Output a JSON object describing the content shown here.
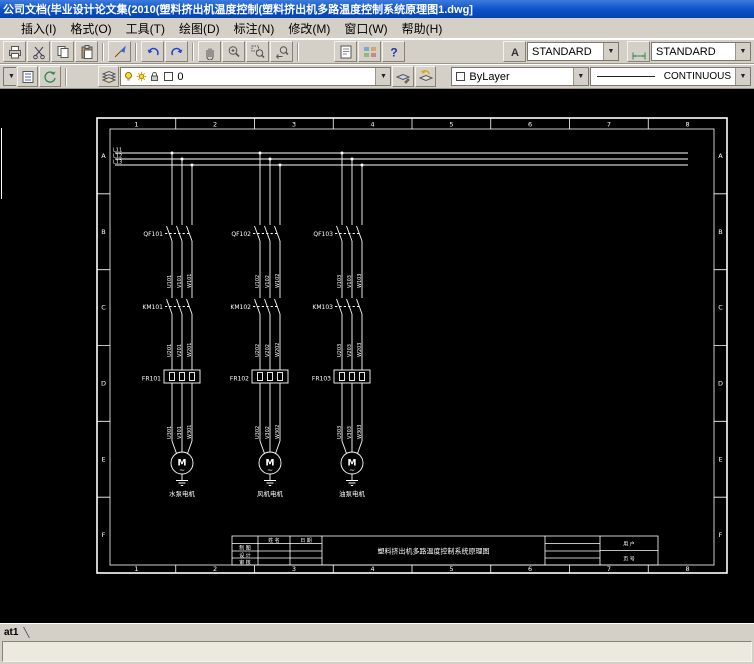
{
  "window": {
    "title": "公司文档(毕业设计论文集(2010(塑料挤出机温度控制(塑料挤出机多路温度控制系统原理图1.dwg]"
  },
  "menu_bar": {
    "items": [
      "插入(I)",
      "格式(O)",
      "工具(T)",
      "绘图(D)",
      "标注(N)",
      "修改(M)",
      "窗口(W)",
      "帮助(H)"
    ]
  },
  "standard_toolbar": {
    "icons": [
      "print",
      "cut",
      "copy",
      "paste",
      "match-properties",
      "undo",
      "redo",
      "pan",
      "zoom-realtime",
      "zoom-window",
      "zoom-previous",
      "properties",
      "designcenter",
      "help",
      "text-style",
      "dim-style"
    ],
    "text_style": "STANDARD",
    "dim_style": "STANDARD"
  },
  "layer_toolbar": {
    "icons": [
      "layer-manager",
      "bulb",
      "sun",
      "lock",
      "color-swatch",
      "make-object-layer-current",
      "layer-previous"
    ],
    "current_layer": "0",
    "color": "ByLayer",
    "linetype": "CONTINUOUS"
  },
  "drawing": {
    "grid_columns": [
      "1",
      "2",
      "3",
      "4",
      "5",
      "6",
      "7",
      "8"
    ],
    "grid_rows": [
      "A",
      "B",
      "C",
      "D",
      "E",
      "F"
    ],
    "power_lines": [
      "L11",
      "L12",
      "L13"
    ],
    "branches": [
      {
        "breaker": "QF101",
        "contactor": "KM101",
        "relay": "FR101",
        "wires1": [
          "U101",
          "V101",
          "W101"
        ],
        "wires2": [
          "U201",
          "V201",
          "W201"
        ],
        "wires3": [
          "U301",
          "V301",
          "W301"
        ],
        "motor": "M",
        "motor_symbol": "~",
        "motor_label": "水泵电机"
      },
      {
        "breaker": "QF102",
        "contactor": "KM102",
        "relay": "FR102",
        "wires1": [
          "U102",
          "V102",
          "W102"
        ],
        "wires2": [
          "U202",
          "V202",
          "W202"
        ],
        "wires3": [
          "U302",
          "V302",
          "W302"
        ],
        "motor": "M",
        "motor_symbol": "~",
        "motor_label": "风机电机"
      },
      {
        "breaker": "QF103",
        "contactor": "KM103",
        "relay": "FR103",
        "wires1": [
          "U103",
          "V103",
          "W103"
        ],
        "wires2": [
          "U203",
          "V203",
          "W203"
        ],
        "wires3": [
          "U303",
          "V303",
          "W303"
        ],
        "motor": "M",
        "motor_symbol": "~",
        "motor_label": "油泵电机"
      }
    ],
    "title_block": {
      "title": "塑料挤出机多路温度控制系统原理图",
      "col_headers": [
        "姓 名",
        "日 期"
      ],
      "row_labels": [
        "制 图",
        "设 计",
        "审 核"
      ],
      "user_label": "用 户",
      "page_label": "页 号"
    }
  },
  "tabs": {
    "layout_tab": "at1"
  },
  "colors": {
    "titlebar": "#0A50C8",
    "chrome": "#D4D0C8",
    "canvas": "#000000",
    "line": "#FFFFFF"
  }
}
